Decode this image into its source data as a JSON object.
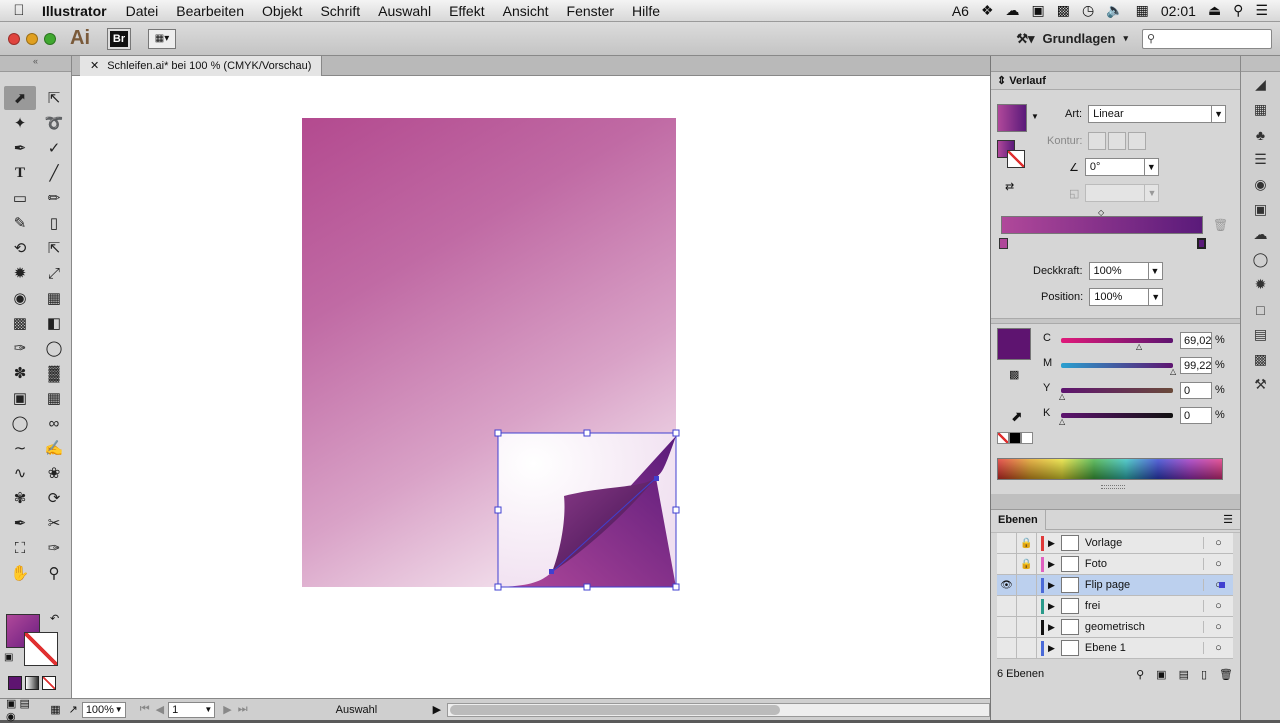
{
  "menubar": {
    "app_name": "Illustrator",
    "items": [
      "Datei",
      "Bearbeiten",
      "Objekt",
      "Schrift",
      "Auswahl",
      "Effekt",
      "Ansicht",
      "Fenster",
      "Hilfe"
    ],
    "tray_count": "6",
    "clock": "02:01"
  },
  "appbar": {
    "logo": "Ai",
    "bridge": "Br",
    "workspace": "Grundlagen",
    "search_placeholder": ""
  },
  "document": {
    "tab_title": "Schleifen.ai* bei 100 % (CMYK/Vorschau)"
  },
  "statusbar": {
    "zoom": "100%",
    "page": "1",
    "mode": "Auswahl"
  },
  "gradient_panel": {
    "title": "Verlauf",
    "art_label": "Art:",
    "art_value": "Linear",
    "kontur_label": "Kontur:",
    "angle_value": "0°",
    "opacity_label": "Deckkraft:",
    "opacity_value": "100%",
    "position_label": "Position:",
    "position_value": "100%",
    "start_color": "#b0489a",
    "end_color": "#5a1a7a"
  },
  "color_panel": {
    "swatch": "#5e1470",
    "channels": [
      {
        "label": "C",
        "value": "69,02",
        "fraction": 0.69
      },
      {
        "label": "M",
        "value": "99,22",
        "fraction": 0.99
      },
      {
        "label": "Y",
        "value": "0",
        "fraction": 0.0
      },
      {
        "label": "K",
        "value": "0",
        "fraction": 0.0
      }
    ],
    "unit": "%"
  },
  "layers_panel": {
    "title": "Ebenen",
    "layers": [
      {
        "name": "Vorlage",
        "locked": true,
        "visible": false,
        "color": "#e03a3a",
        "selected": false
      },
      {
        "name": "Foto",
        "locked": true,
        "visible": false,
        "color": "#e060c0",
        "selected": false
      },
      {
        "name": "Flip page",
        "locked": false,
        "visible": true,
        "color": "#4a6ad8",
        "selected": true
      },
      {
        "name": "frei",
        "locked": false,
        "visible": false,
        "color": "#2a9a8a",
        "selected": false
      },
      {
        "name": "geometrisch",
        "locked": false,
        "visible": false,
        "color": "#111111",
        "selected": false
      },
      {
        "name": "Ebene 1",
        "locked": false,
        "visible": false,
        "color": "#4a6ad8",
        "selected": false
      }
    ],
    "count": "6 Ebenen"
  },
  "colors": {
    "selection_blue": "#4040d0",
    "artboard_pink": "#b34a8f",
    "flip_purple": "#6a1e80"
  }
}
